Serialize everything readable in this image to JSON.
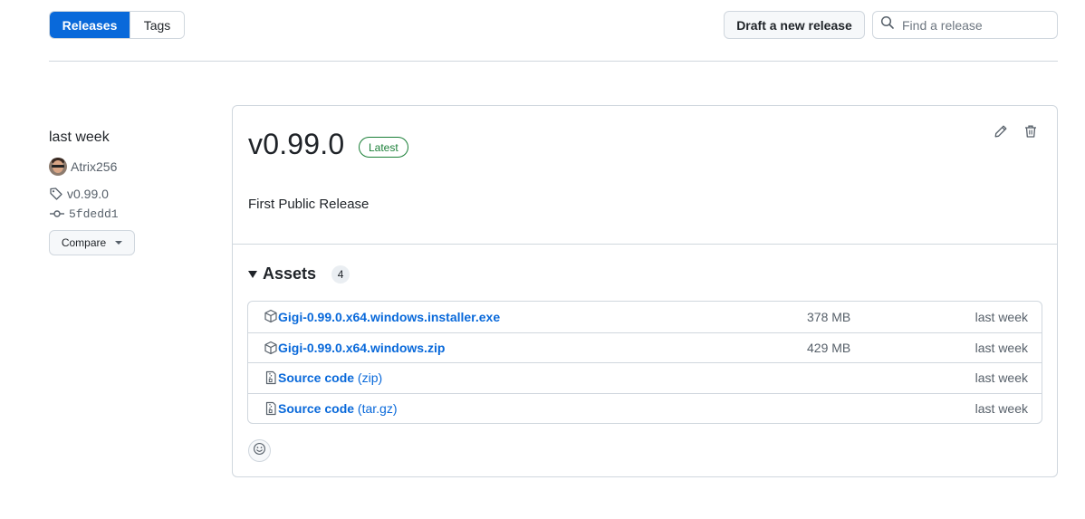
{
  "tabs": [
    {
      "label": "Releases",
      "active": true
    },
    {
      "label": "Tags",
      "active": false
    }
  ],
  "toolbar": {
    "draft_label": "Draft a new release",
    "search_placeholder": "Find a release"
  },
  "meta": {
    "date": "last week",
    "author": "Atrix256",
    "tag": "v0.99.0",
    "commit": "5fdedd1",
    "compare_label": "Compare"
  },
  "release": {
    "title": "v0.99.0",
    "badge": "Latest",
    "body": "First Public Release",
    "assets_title": "Assets",
    "assets_count": "4",
    "assets": [
      {
        "icon": "package-icon",
        "name": "Gigi-0.99.0.x64.windows.installer.exe",
        "sub": "",
        "size": "378 MB",
        "date": "last week"
      },
      {
        "icon": "package-icon",
        "name": "Gigi-0.99.0.x64.windows.zip",
        "sub": "",
        "size": "429 MB",
        "date": "last week"
      },
      {
        "icon": "file-zip-icon",
        "name": "Source code",
        "sub": " (zip)",
        "size": "",
        "date": "last week"
      },
      {
        "icon": "file-zip-icon",
        "name": "Source code",
        "sub": " (tar.gz)",
        "size": "",
        "date": "last week"
      }
    ]
  },
  "colors": {
    "accent": "#0969da",
    "latest_green": "#1a7f37",
    "border": "#d0d7de"
  }
}
